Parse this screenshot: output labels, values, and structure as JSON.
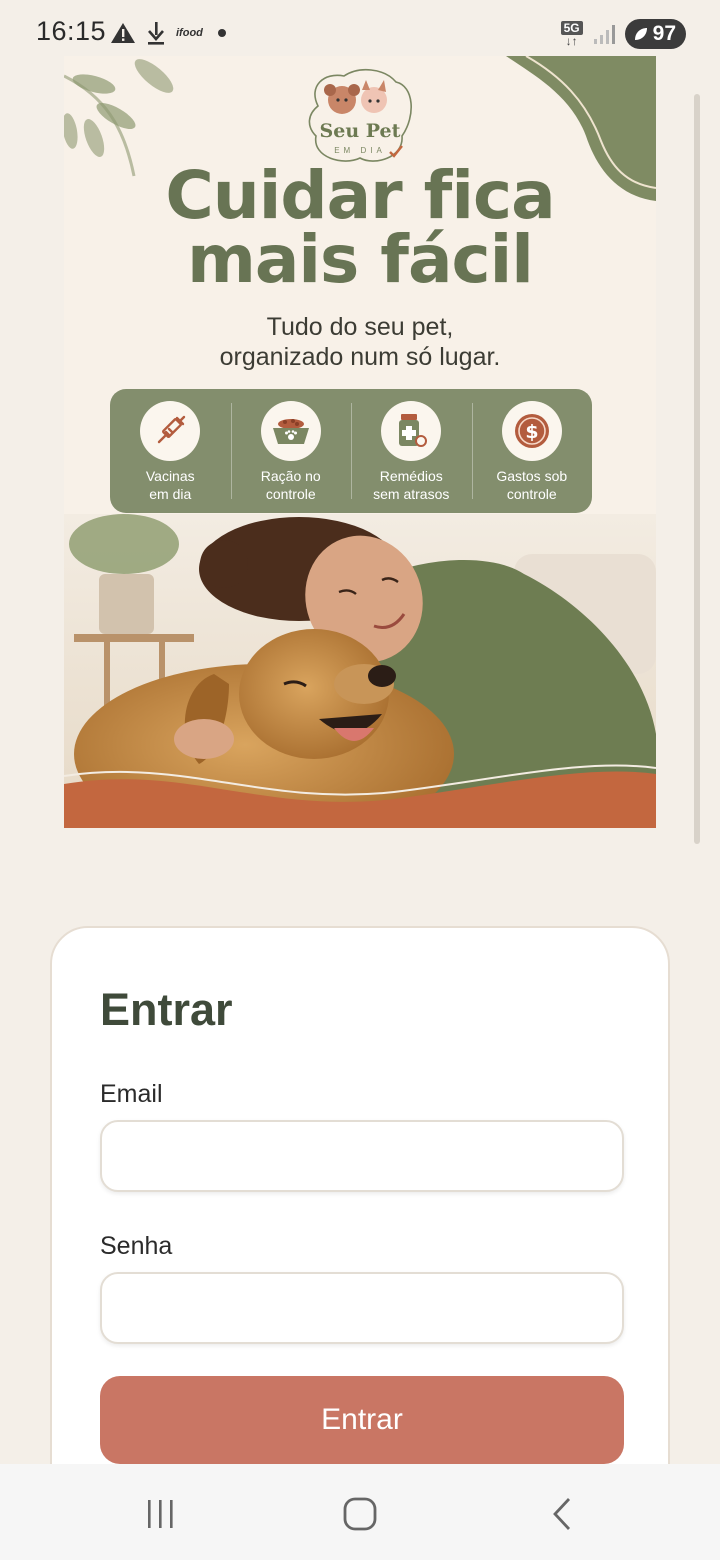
{
  "status_bar": {
    "time": "16:15",
    "left_icons": [
      "alert-icon",
      "download-icon",
      "ifood-icon",
      "dot-icon"
    ],
    "ifood_label": "ifood",
    "network": "5G",
    "battery": "97"
  },
  "banner": {
    "logo_text": "Seu Pet",
    "logo_sub": "EM DIA",
    "headline_line1": "Cuidar fica",
    "headline_line2": "mais fácil",
    "subline_line1": "Tudo do seu pet,",
    "subline_line2": "organizado num só lugar.",
    "features": [
      {
        "icon": "syringe-icon",
        "line1": "Vacinas",
        "line2": "em dia"
      },
      {
        "icon": "pet-food-bowl-icon",
        "line1": "Ração no",
        "line2": "controle"
      },
      {
        "icon": "medicine-bottle-icon",
        "line1": "Remédios",
        "line2": "sem atrasos"
      },
      {
        "icon": "dollar-coin-icon",
        "line1": "Gastos sob",
        "line2": "controle"
      }
    ],
    "colors": {
      "olive": "#687454",
      "panel": "#838e6d",
      "terracotta": "#c3673f"
    }
  },
  "login": {
    "title": "Entrar",
    "email_label": "Email",
    "email_value": "",
    "password_label": "Senha",
    "password_value": "",
    "submit_label": "Entrar",
    "accent_color": "#c97664"
  },
  "nav": {
    "recent_icon": "recent-apps-icon",
    "home_icon": "home-icon",
    "back_icon": "back-icon"
  }
}
